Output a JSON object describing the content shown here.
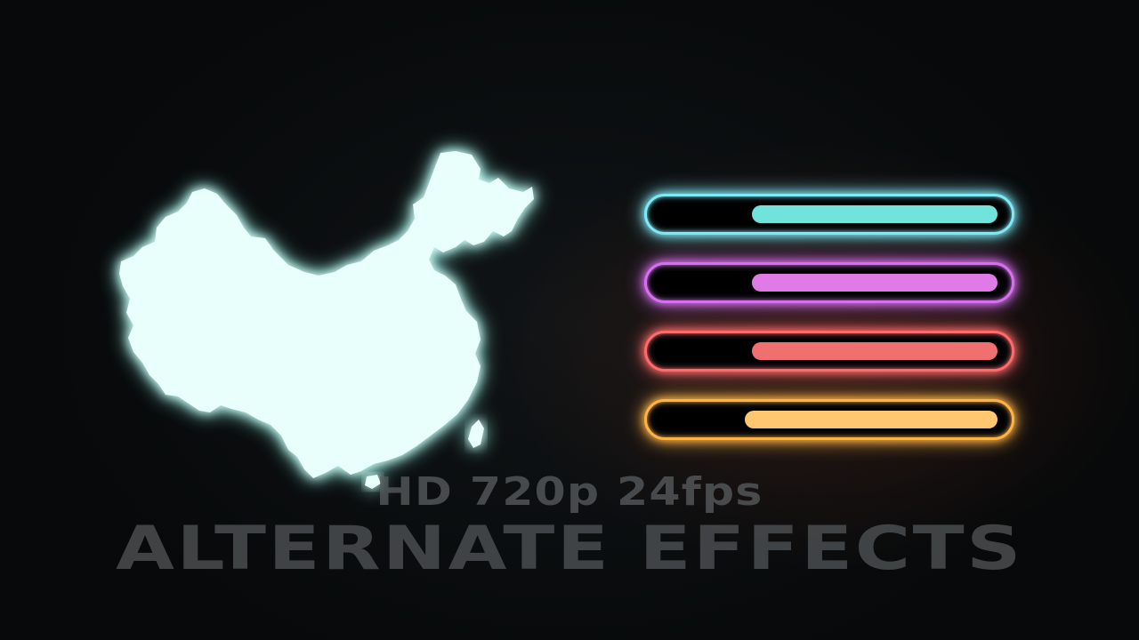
{
  "overlay": {
    "line1": "HD 720p 24fps",
    "line2": "ALTERNATE EFFECTS"
  },
  "map": {
    "icon": "china-map-icon",
    "color": "#e8fffb",
    "glow": "#8ff5e8"
  },
  "bars": [
    {
      "name": "cyan",
      "color": "#6fe3dc",
      "frame": "#7fe9f5",
      "fill": 0.72
    },
    {
      "name": "magenta",
      "color": "#e07ae6",
      "frame": "#d86ff0",
      "fill": 0.72
    },
    {
      "name": "red",
      "color": "#f07070",
      "frame": "#ff6a6a",
      "fill": 0.72
    },
    {
      "name": "orange",
      "color": "#ffc870",
      "frame": "#ffb347",
      "fill": 0.74
    }
  ]
}
